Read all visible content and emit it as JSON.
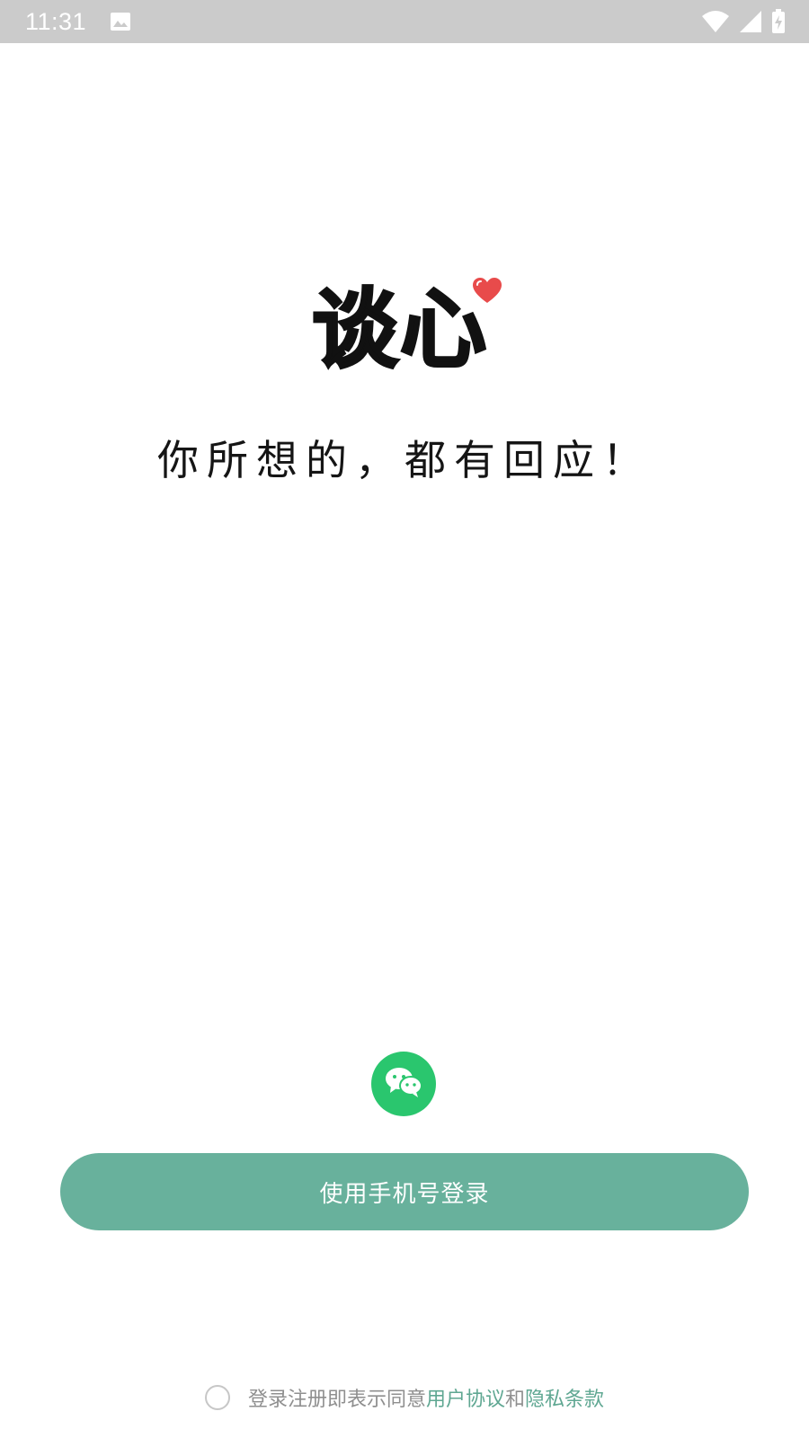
{
  "status_bar": {
    "time": "11:31",
    "icons": [
      "image-icon",
      "wifi-icon",
      "cell-signal-icon",
      "battery-charging-icon"
    ]
  },
  "brand": {
    "logo_text": "谈心",
    "slogan": "你所想的，都有回应！"
  },
  "login": {
    "wechat_icon": "wechat-icon",
    "phone_login_label": "使用手机号登录"
  },
  "agreement": {
    "prefix": "登录注册即表示同意",
    "user_agreement": "用户协议",
    "conjunction": "和",
    "privacy_policy": "隐私条款",
    "checked": false
  },
  "colors": {
    "primary": "#68b19c",
    "wechat": "#2ac66e",
    "heart": "#e84b4b",
    "link": "#5fa792",
    "status_bar": "#cbcbcb"
  }
}
